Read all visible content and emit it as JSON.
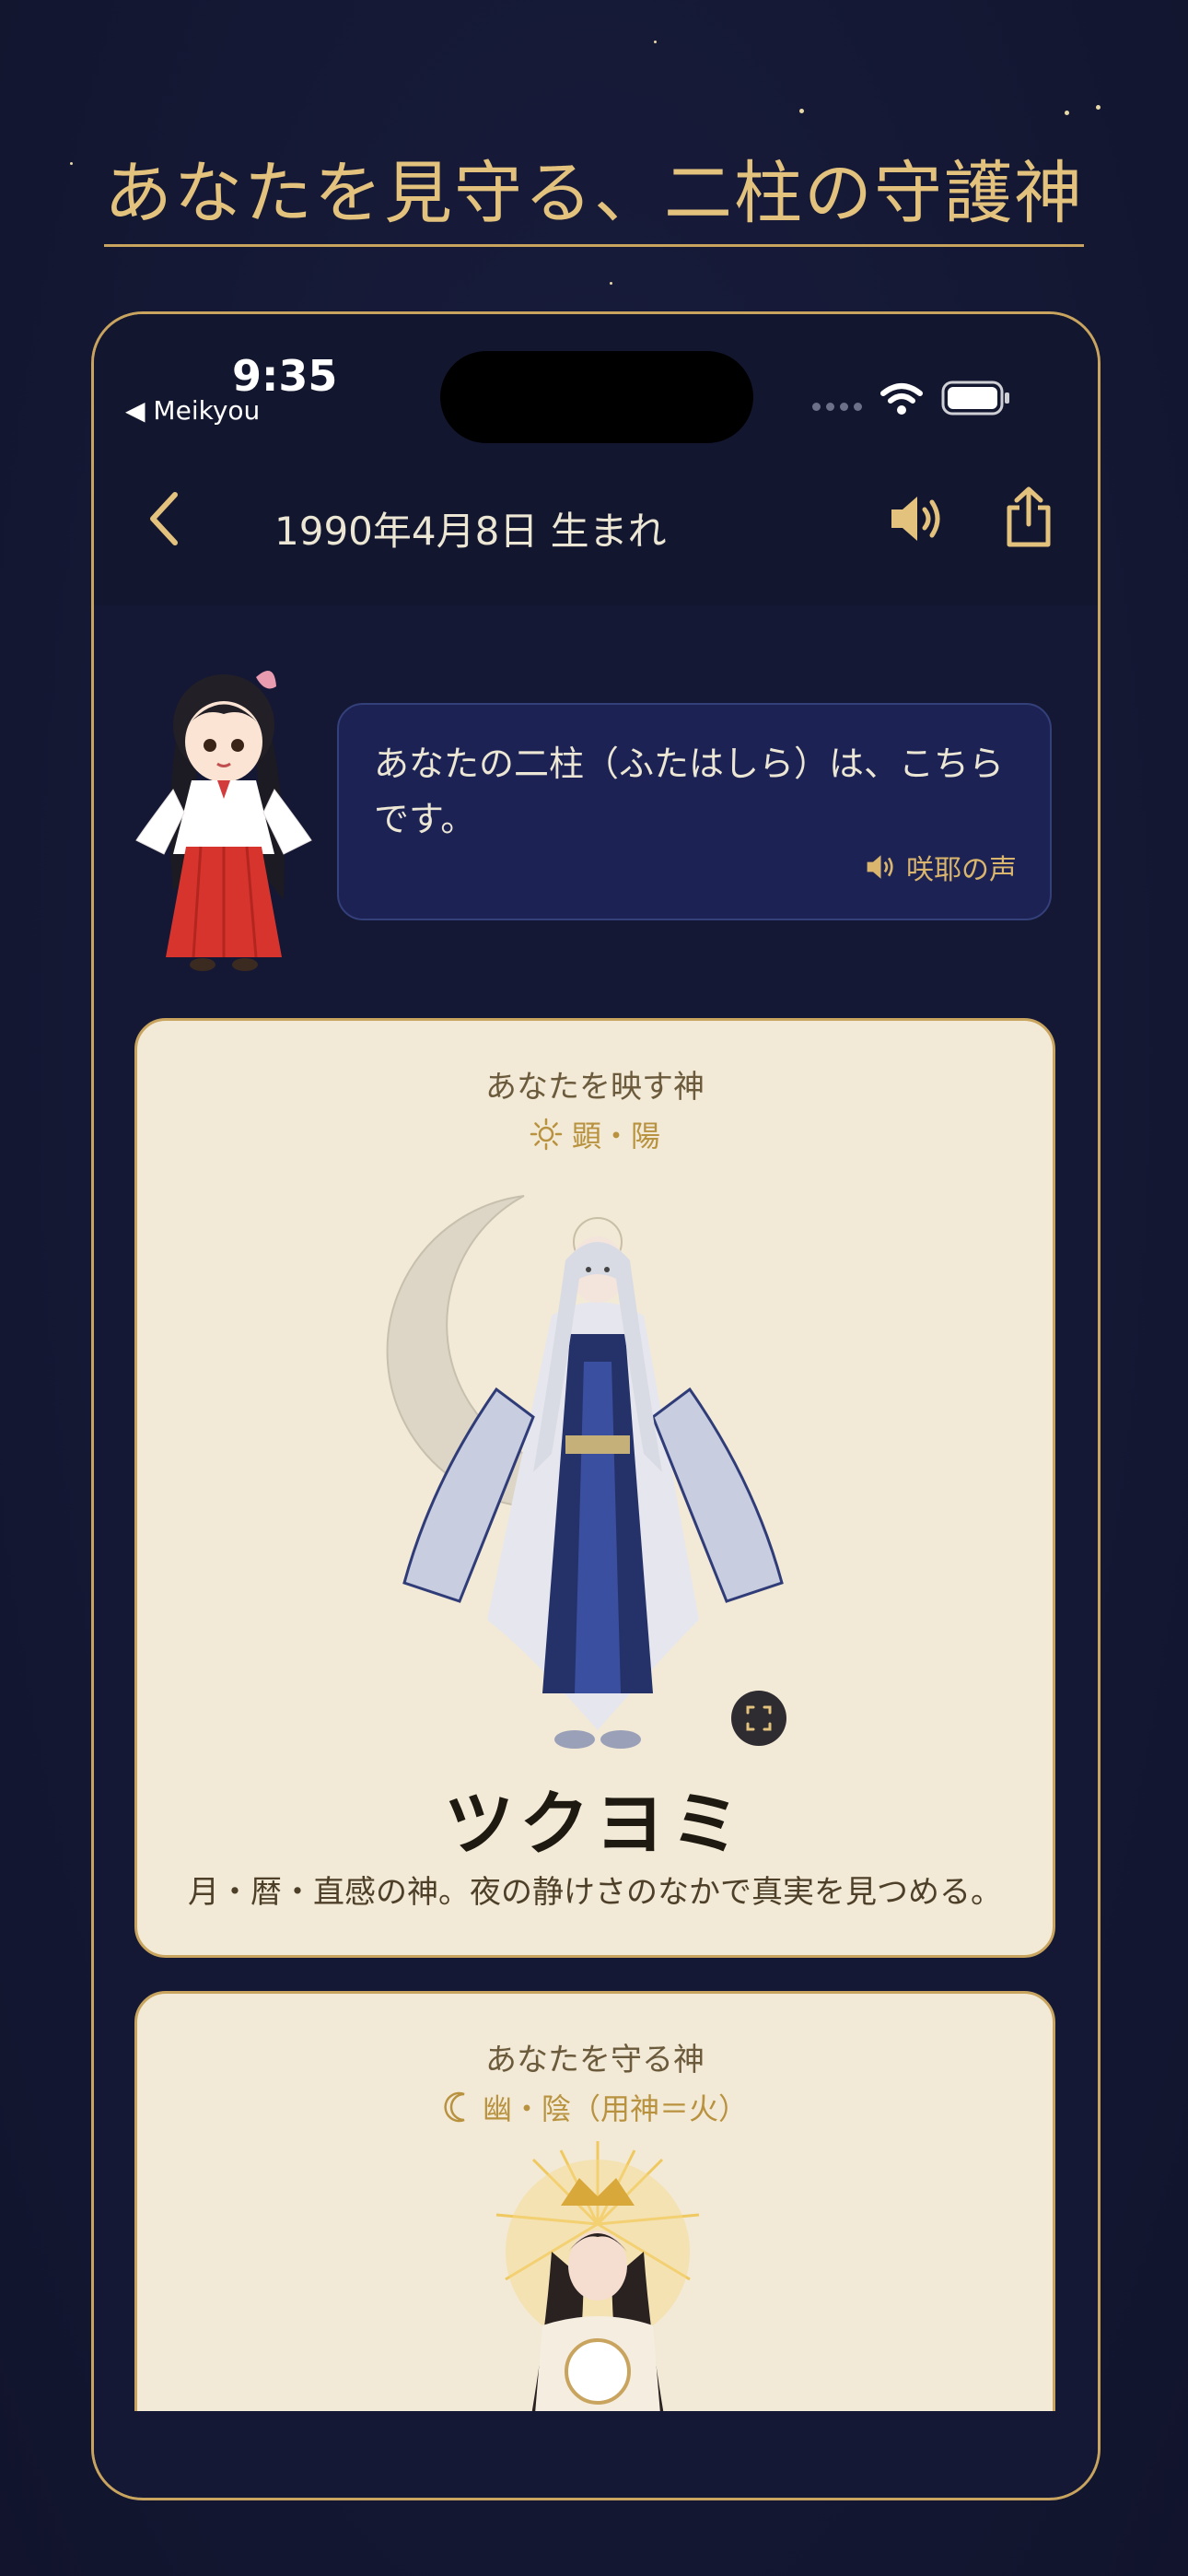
{
  "headline": "あなたを見守る、二柱の守護神",
  "status_bar": {
    "time": "9:35",
    "back_app": "◀ Meikyou"
  },
  "nav": {
    "title": "1990年4月8日 生まれ"
  },
  "bubble": {
    "text": "あなたの二柱（ふたはしら）は、こちらです。",
    "voice_label": "咲耶の声"
  },
  "cards": [
    {
      "subtitle": "あなたを映す神",
      "tag": "顕・陽",
      "tag_icon": "sun-icon",
      "name": "ツクヨミ",
      "description": "月・暦・直感の神。夜の静けさのなかで真実を見つめる。"
    },
    {
      "subtitle": "あなたを守る神",
      "tag": "幽・陰（用神＝火）",
      "tag_icon": "crescent-moon-icon"
    }
  ],
  "colors": {
    "gold": "#c9a45f",
    "background": "#141834",
    "card": "#f2ead6",
    "bubble": "#1c2254"
  }
}
